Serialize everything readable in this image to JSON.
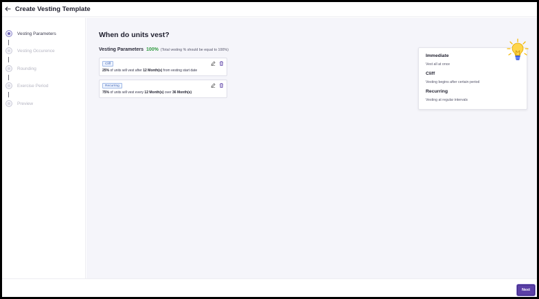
{
  "header": {
    "title": "Create Vesting Template"
  },
  "sidebar": {
    "steps": [
      {
        "label": "Vesting Parameters",
        "active": true
      },
      {
        "label": "Vesting Occurence",
        "active": false
      },
      {
        "label": "Rounding",
        "active": false
      },
      {
        "label": "Exercise Period",
        "active": false
      },
      {
        "label": "Preview",
        "active": false
      }
    ]
  },
  "main": {
    "heading": "When do units vest?",
    "vesting_parameters_label": "Vesting Parameters",
    "vesting_total": "100%",
    "vesting_note": "(Total vesting % should be equal to 100%)",
    "cards": [
      {
        "badge": "Cliff",
        "percent": "25%",
        "text1": " of units will vest after ",
        "duration": "12 Month(s)",
        "text2": " from vesting start date",
        "text3": "",
        "duration2": ""
      },
      {
        "badge": "Recurring",
        "percent": "75%",
        "text1": " of units will vest every ",
        "duration": "12 Month(s)",
        "text2": " over ",
        "text3": "",
        "duration2": "36 Month(s)"
      }
    ]
  },
  "info_panel": {
    "items": [
      {
        "title": "Immediate",
        "desc": "Vest all at once"
      },
      {
        "title": "Cliff",
        "desc": "Vesting begins after certain period"
      },
      {
        "title": "Recurring",
        "desc": "Vesting at regular intervals"
      }
    ]
  },
  "footer": {
    "next_label": "Next"
  },
  "colors": {
    "accent": "#5b3fa6",
    "success": "#2e9a3e",
    "badge_border": "#9fb8e6"
  }
}
